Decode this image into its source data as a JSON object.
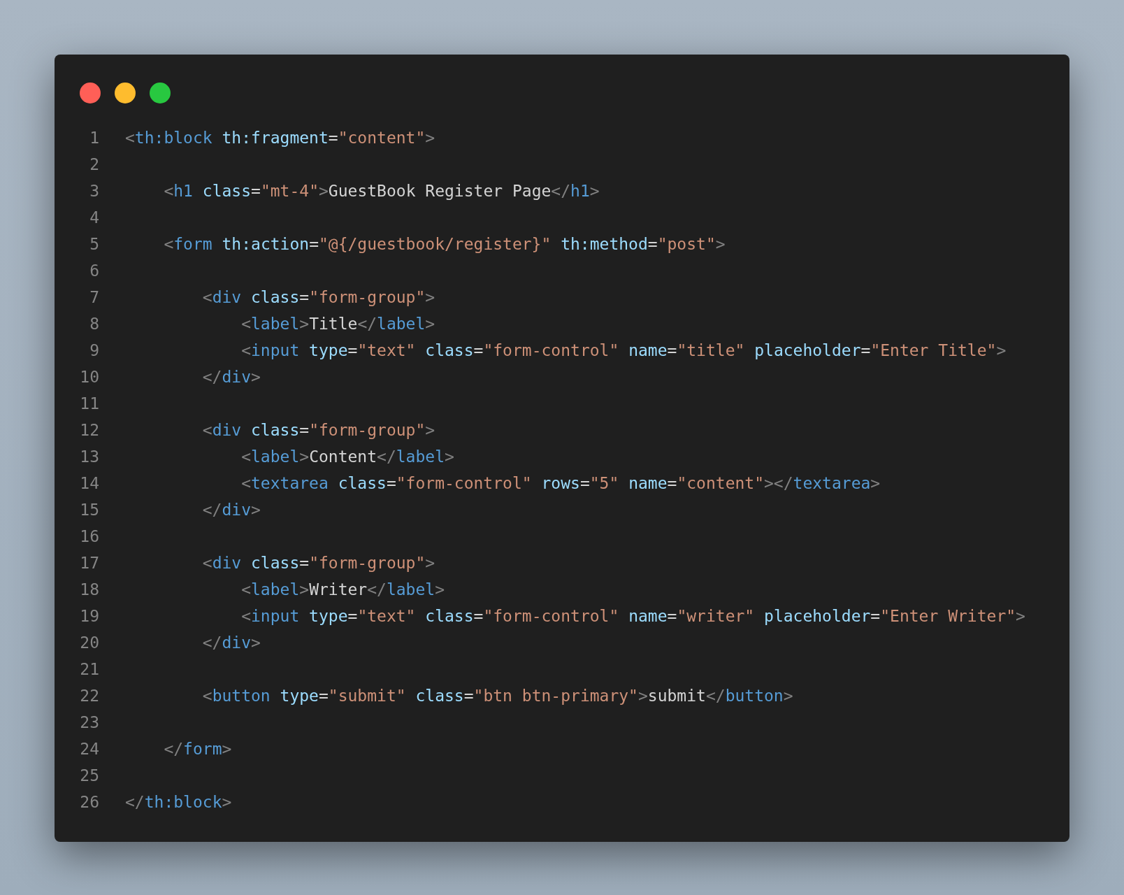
{
  "editor": {
    "lines": [
      {
        "number": "1",
        "tokens": [
          {
            "kind": "p",
            "text": "<"
          },
          {
            "kind": "t",
            "text": "th:block"
          },
          {
            "kind": "a",
            "text": " th:fragment"
          },
          {
            "kind": "e",
            "text": "="
          },
          {
            "kind": "s",
            "text": "\"content\""
          },
          {
            "kind": "p",
            "text": ">"
          }
        ]
      },
      {
        "number": "2"
      },
      {
        "number": "3",
        "tokens": [
          {
            "kind": "p",
            "text": "    <"
          },
          {
            "kind": "t",
            "text": "h1"
          },
          {
            "kind": "a",
            "text": " class"
          },
          {
            "kind": "e",
            "text": "="
          },
          {
            "kind": "s",
            "text": "\"mt-4\""
          },
          {
            "kind": "p",
            "text": ">"
          },
          {
            "kind": "x",
            "text": "GuestBook Register Page"
          },
          {
            "kind": "p",
            "text": "</"
          },
          {
            "kind": "t",
            "text": "h1"
          },
          {
            "kind": "p",
            "text": ">"
          }
        ]
      },
      {
        "number": "4"
      },
      {
        "number": "5",
        "tokens": [
          {
            "kind": "p",
            "text": "    <"
          },
          {
            "kind": "t",
            "text": "form"
          },
          {
            "kind": "a",
            "text": " th:action"
          },
          {
            "kind": "e",
            "text": "="
          },
          {
            "kind": "s",
            "text": "\"@{/guestbook/register}\""
          },
          {
            "kind": "a",
            "text": " th:method"
          },
          {
            "kind": "e",
            "text": "="
          },
          {
            "kind": "s",
            "text": "\"post\""
          },
          {
            "kind": "p",
            "text": ">"
          }
        ]
      },
      {
        "number": "6"
      },
      {
        "number": "7",
        "tokens": [
          {
            "kind": "p",
            "text": "        <"
          },
          {
            "kind": "t",
            "text": "div"
          },
          {
            "kind": "a",
            "text": " class"
          },
          {
            "kind": "e",
            "text": "="
          },
          {
            "kind": "s",
            "text": "\"form-group\""
          },
          {
            "kind": "p",
            "text": ">"
          }
        ]
      },
      {
        "number": "8",
        "tokens": [
          {
            "kind": "p",
            "text": "            <"
          },
          {
            "kind": "t",
            "text": "label"
          },
          {
            "kind": "p",
            "text": ">"
          },
          {
            "kind": "x",
            "text": "Title"
          },
          {
            "kind": "p",
            "text": "</"
          },
          {
            "kind": "t",
            "text": "label"
          },
          {
            "kind": "p",
            "text": ">"
          }
        ]
      },
      {
        "number": "9",
        "tokens": [
          {
            "kind": "p",
            "text": "            <"
          },
          {
            "kind": "t",
            "text": "input"
          },
          {
            "kind": "a",
            "text": " type"
          },
          {
            "kind": "e",
            "text": "="
          },
          {
            "kind": "s",
            "text": "\"text\""
          },
          {
            "kind": "a",
            "text": " class"
          },
          {
            "kind": "e",
            "text": "="
          },
          {
            "kind": "s",
            "text": "\"form-control\""
          },
          {
            "kind": "a",
            "text": " name"
          },
          {
            "kind": "e",
            "text": "="
          },
          {
            "kind": "s",
            "text": "\"title\""
          },
          {
            "kind": "a",
            "text": " placeholder"
          },
          {
            "kind": "e",
            "text": "="
          },
          {
            "kind": "s",
            "text": "\"Enter Title\""
          },
          {
            "kind": "p",
            "text": ">"
          }
        ]
      },
      {
        "number": "10",
        "tokens": [
          {
            "kind": "p",
            "text": "        </"
          },
          {
            "kind": "t",
            "text": "div"
          },
          {
            "kind": "p",
            "text": ">"
          }
        ]
      },
      {
        "number": "11"
      },
      {
        "number": "12",
        "tokens": [
          {
            "kind": "p",
            "text": "        <"
          },
          {
            "kind": "t",
            "text": "div"
          },
          {
            "kind": "a",
            "text": " class"
          },
          {
            "kind": "e",
            "text": "="
          },
          {
            "kind": "s",
            "text": "\"form-group\""
          },
          {
            "kind": "p",
            "text": ">"
          }
        ]
      },
      {
        "number": "13",
        "tokens": [
          {
            "kind": "p",
            "text": "            <"
          },
          {
            "kind": "t",
            "text": "label"
          },
          {
            "kind": "p",
            "text": ">"
          },
          {
            "kind": "x",
            "text": "Content"
          },
          {
            "kind": "p",
            "text": "</"
          },
          {
            "kind": "t",
            "text": "label"
          },
          {
            "kind": "p",
            "text": ">"
          }
        ]
      },
      {
        "number": "14",
        "tokens": [
          {
            "kind": "p",
            "text": "            <"
          },
          {
            "kind": "t",
            "text": "textarea"
          },
          {
            "kind": "a",
            "text": " class"
          },
          {
            "kind": "e",
            "text": "="
          },
          {
            "kind": "s",
            "text": "\"form-control\""
          },
          {
            "kind": "a",
            "text": " rows"
          },
          {
            "kind": "e",
            "text": "="
          },
          {
            "kind": "s",
            "text": "\"5\""
          },
          {
            "kind": "a",
            "text": " name"
          },
          {
            "kind": "e",
            "text": "="
          },
          {
            "kind": "s",
            "text": "\"content\""
          },
          {
            "kind": "p",
            "text": "></"
          },
          {
            "kind": "t",
            "text": "textarea"
          },
          {
            "kind": "p",
            "text": ">"
          }
        ]
      },
      {
        "number": "15",
        "tokens": [
          {
            "kind": "p",
            "text": "        </"
          },
          {
            "kind": "t",
            "text": "div"
          },
          {
            "kind": "p",
            "text": ">"
          }
        ]
      },
      {
        "number": "16"
      },
      {
        "number": "17",
        "tokens": [
          {
            "kind": "p",
            "text": "        <"
          },
          {
            "kind": "t",
            "text": "div"
          },
          {
            "kind": "a",
            "text": " class"
          },
          {
            "kind": "e",
            "text": "="
          },
          {
            "kind": "s",
            "text": "\"form-group\""
          },
          {
            "kind": "p",
            "text": ">"
          }
        ]
      },
      {
        "number": "18",
        "tokens": [
          {
            "kind": "p",
            "text": "            <"
          },
          {
            "kind": "t",
            "text": "label"
          },
          {
            "kind": "p",
            "text": ">"
          },
          {
            "kind": "x",
            "text": "Writer"
          },
          {
            "kind": "p",
            "text": "</"
          },
          {
            "kind": "t",
            "text": "label"
          },
          {
            "kind": "p",
            "text": ">"
          }
        ]
      },
      {
        "number": "19",
        "tokens": [
          {
            "kind": "p",
            "text": "            <"
          },
          {
            "kind": "t",
            "text": "input"
          },
          {
            "kind": "a",
            "text": " type"
          },
          {
            "kind": "e",
            "text": "="
          },
          {
            "kind": "s",
            "text": "\"text\""
          },
          {
            "kind": "a",
            "text": " class"
          },
          {
            "kind": "e",
            "text": "="
          },
          {
            "kind": "s",
            "text": "\"form-control\""
          },
          {
            "kind": "a",
            "text": " name"
          },
          {
            "kind": "e",
            "text": "="
          },
          {
            "kind": "s",
            "text": "\"writer\""
          },
          {
            "kind": "a",
            "text": " placeholder"
          },
          {
            "kind": "e",
            "text": "="
          },
          {
            "kind": "s",
            "text": "\"Enter Writer\""
          },
          {
            "kind": "p",
            "text": ">"
          }
        ]
      },
      {
        "number": "20",
        "tokens": [
          {
            "kind": "p",
            "text": "        </"
          },
          {
            "kind": "t",
            "text": "div"
          },
          {
            "kind": "p",
            "text": ">"
          }
        ]
      },
      {
        "number": "21"
      },
      {
        "number": "22",
        "tokens": [
          {
            "kind": "p",
            "text": "        <"
          },
          {
            "kind": "t",
            "text": "button"
          },
          {
            "kind": "a",
            "text": " type"
          },
          {
            "kind": "e",
            "text": "="
          },
          {
            "kind": "s",
            "text": "\"submit\""
          },
          {
            "kind": "a",
            "text": " class"
          },
          {
            "kind": "e",
            "text": "="
          },
          {
            "kind": "s",
            "text": "\"btn btn-primary\""
          },
          {
            "kind": "p",
            "text": ">"
          },
          {
            "kind": "x",
            "text": "submit"
          },
          {
            "kind": "p",
            "text": "</"
          },
          {
            "kind": "t",
            "text": "button"
          },
          {
            "kind": "p",
            "text": ">"
          }
        ]
      },
      {
        "number": "23"
      },
      {
        "number": "24",
        "tokens": [
          {
            "kind": "p",
            "text": "    </"
          },
          {
            "kind": "t",
            "text": "form"
          },
          {
            "kind": "p",
            "text": ">"
          }
        ]
      },
      {
        "number": "25"
      },
      {
        "number": "26",
        "tokens": [
          {
            "kind": "p",
            "text": "</"
          },
          {
            "kind": "t",
            "text": "th:block"
          },
          {
            "kind": "p",
            "text": ">"
          }
        ]
      }
    ]
  }
}
